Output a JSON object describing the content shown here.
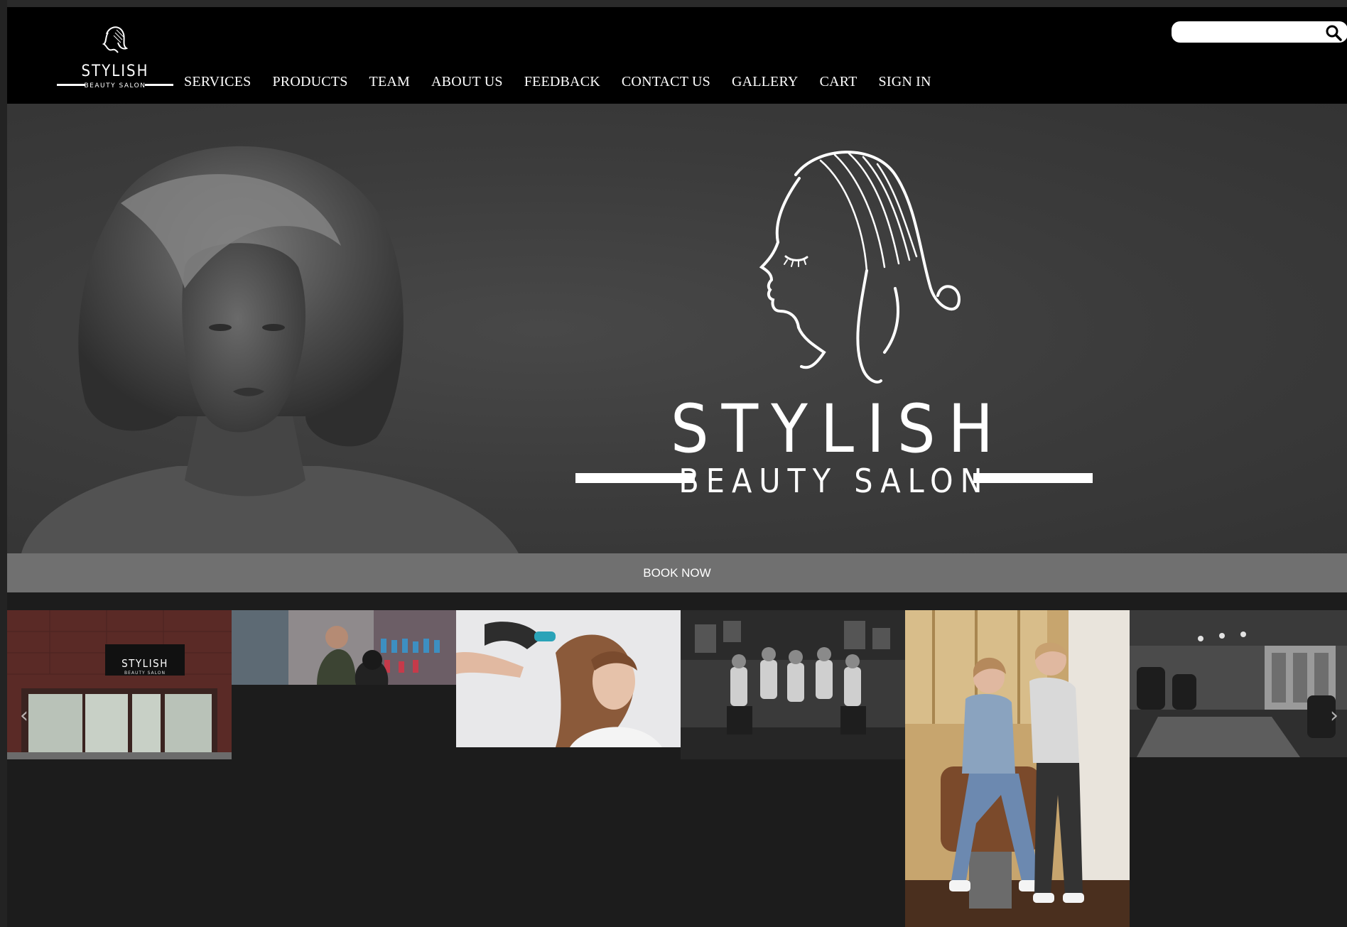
{
  "header": {
    "logo": {
      "name": "STYLISH",
      "tagline": "BEAUTY SALON"
    },
    "nav": [
      {
        "label": "SERVICES"
      },
      {
        "label": "PRODUCTS"
      },
      {
        "label": "TEAM"
      },
      {
        "label": "ABOUT US"
      },
      {
        "label": "FEEDBACK"
      },
      {
        "label": "CONTACT US"
      },
      {
        "label": "GALLERY"
      },
      {
        "label": "CART"
      },
      {
        "label": "SIGN IN"
      }
    ],
    "search": {
      "placeholder": "",
      "value": "",
      "icon": "search-icon"
    }
  },
  "hero": {
    "brand": "STYLISH",
    "tagline": "BEAUTY SALON",
    "image": "woman-portrait-bob-haircut"
  },
  "book": {
    "label": "BOOK NOW"
  },
  "gallery": {
    "items": [
      {
        "subject": "salon-storefront",
        "sign_name": "STYLISH",
        "sign_tagline": "BEAUTY SALON"
      },
      {
        "subject": "stylist-cutting-hair"
      },
      {
        "subject": "woman-hair-styling"
      },
      {
        "subject": "barber-team-portrait"
      },
      {
        "subject": "two-stylists-in-barber-chair"
      },
      {
        "subject": "salon-interior"
      }
    ],
    "prev_icon": "chevron-left-icon",
    "next_icon": "chevron-right-icon"
  },
  "colors": {
    "header_bg": "#000000",
    "hero_bg": "#3b3b3b",
    "book_bar": "#707070",
    "page_bg": "#1c1c1c",
    "text": "#ffffff"
  }
}
